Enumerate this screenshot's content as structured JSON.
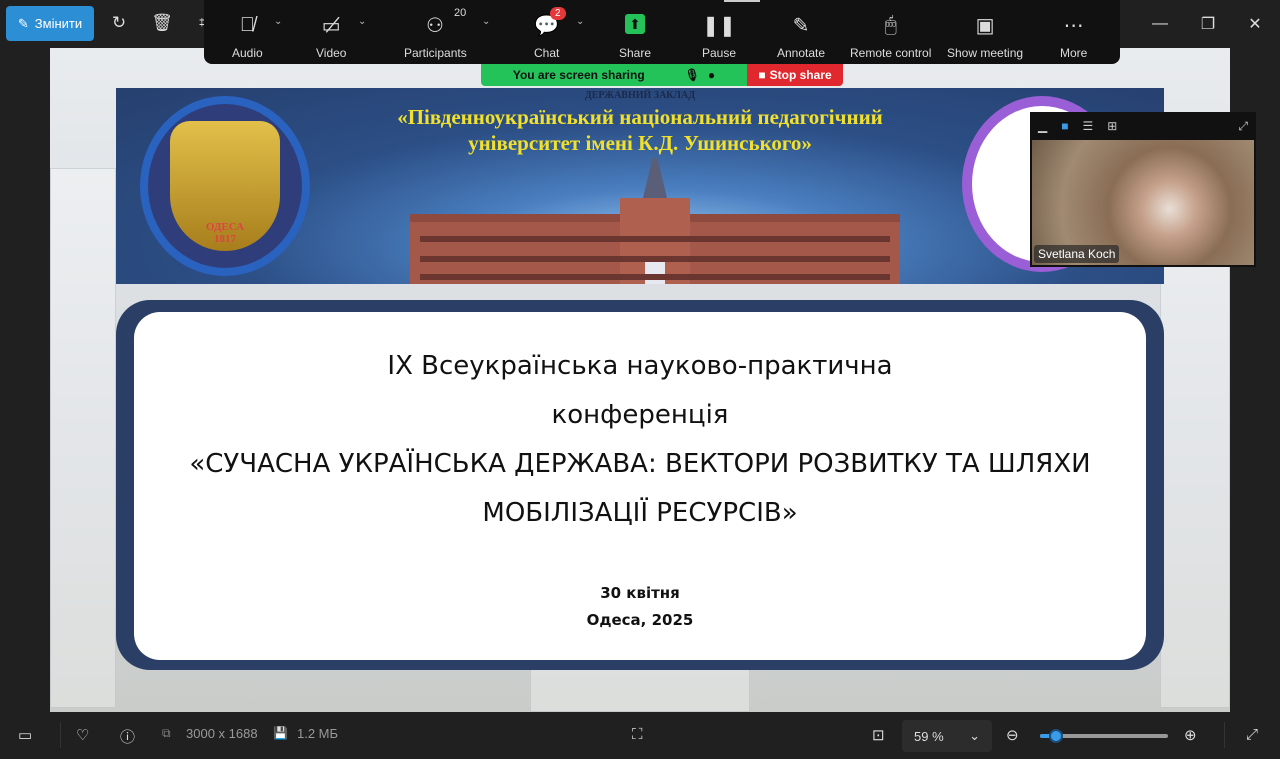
{
  "viewer": {
    "edit_label": "Змінити",
    "window_controls": [
      "minimize-icon",
      "restore-icon",
      "close-icon"
    ]
  },
  "zoom_toolbar": {
    "items": [
      {
        "label": "Audio",
        "icon": "mic-muted-icon"
      },
      {
        "label": "Video",
        "icon": "video-off-icon"
      },
      {
        "label": "Participants",
        "icon": "participants-icon",
        "count": "20"
      },
      {
        "label": "Chat",
        "icon": "chat-icon",
        "badge": "2"
      },
      {
        "label": "Share",
        "icon": "share-icon"
      },
      {
        "label": "Pause",
        "icon": "pause-icon"
      },
      {
        "label": "Annotate",
        "icon": "pencil-icon"
      },
      {
        "label": "Remote control",
        "icon": "mouse-icon"
      },
      {
        "label": "Show meeting",
        "icon": "meeting-icon"
      },
      {
        "label": "More",
        "icon": "more-icon"
      }
    ],
    "sharing_status": "You are screen sharing",
    "stop_share": "Stop share",
    "accent": "#24c35a",
    "stop_color": "#e0282e"
  },
  "slide": {
    "banner_sub": "ДЕРЖАВНИЙ ЗАКЛАД",
    "banner_title_1": "«Південноукраїнський національний педагогічний",
    "banner_title_2": "університет імені К.Д. Ушинського»",
    "seal_city": "ОДЕСА",
    "seal_year": "1817",
    "title_lines": [
      "IX Всеукраїнська науково-практична",
      "конференція",
      "«СУЧАСНА УКРАЇНСЬКА ДЕРЖАВА: ВЕКТОРИ РОЗВИТКУ ТА ШЛЯХИ",
      "МОБІЛІЗАЦІЇ РЕСУРСІВ»"
    ],
    "date": "30 квітня",
    "place": "Одеса, 2025"
  },
  "video": {
    "participant": "Svetlana Koch"
  },
  "bottom_bar": {
    "dimensions": "3000 x 1688",
    "file_size": "1.2 МБ",
    "zoom": "59 %",
    "zoom_slider_fraction": 0.1
  }
}
